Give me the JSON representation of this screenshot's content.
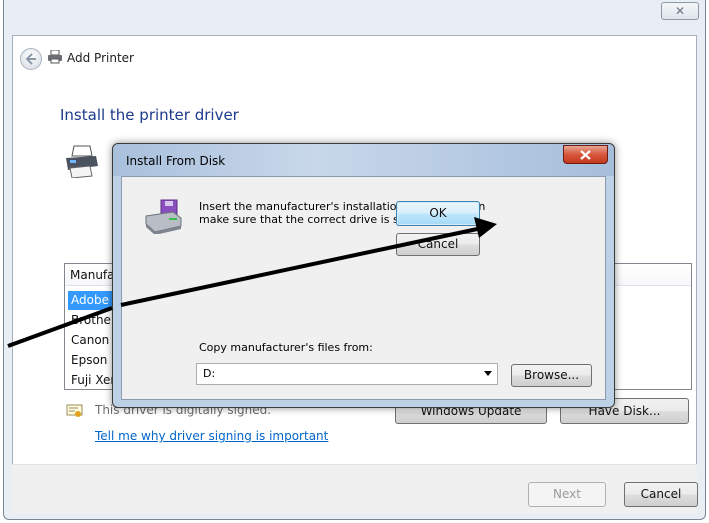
{
  "wizard": {
    "title": "Add Printer",
    "heading": "Install the printer driver",
    "list": {
      "header": "Manufa",
      "items": [
        "Adobe",
        "Brother",
        "Canon",
        "Epson",
        "Fuji Xerox"
      ]
    },
    "signed_text": "This driver is digitally signed.",
    "windows_update_label": "Windows Update",
    "have_disk_label": "Have Disk...",
    "signing_link": "Tell me why driver signing is important",
    "next_label": "Next",
    "cancel_label": "Cancel",
    "close_glyph": "✕"
  },
  "dialog": {
    "title": "Install From Disk",
    "message": "Insert the manufacturer's installation disk, and then make sure that the correct drive is selected below.",
    "ok_label": "OK",
    "cancel_label": "Cancel",
    "copy_label": "Copy manufacturer's files from:",
    "path_value": "D:",
    "browse_label": "Browse..."
  },
  "icons": {
    "back": "back-arrow-icon",
    "printer": "printer-icon",
    "disk": "floppy-disk-icon",
    "certificate": "certificate-icon",
    "close": "close-icon",
    "dropdown": "chevron-down-icon"
  },
  "colors": {
    "heading": "#1b3a8a",
    "link": "#0066cc",
    "selection": "#3399ff",
    "dialog_close": "#c23a20"
  }
}
